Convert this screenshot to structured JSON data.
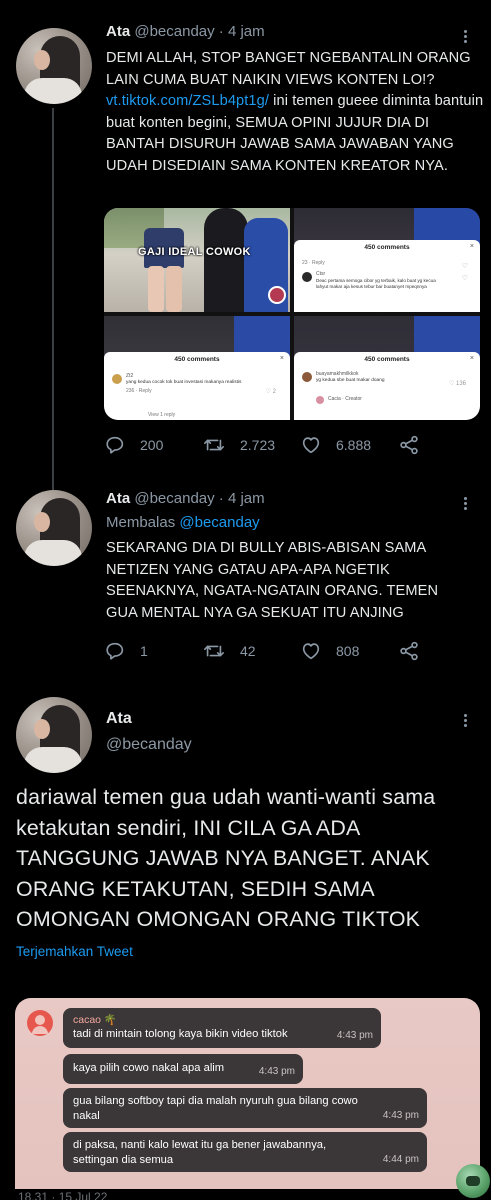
{
  "tweets": [
    {
      "name": "Ata",
      "handle_time": "@becanday · 4 jam",
      "text_parts": {
        "p1": "DEMI ALLAH, STOP BANGET NGEBANTALIN ORANG LAIN CUMA BUAT NAIKIN VIEWS KONTEN LO!? ",
        "link": "vt.tiktok.com/ZSLb4pt1g/",
        "p2": " ini temen gueee diminta bantuin buat konten begini, SEMUA OPINI JUJUR DIA DI BANTAH DISURUH JAWAB SAMA JAWABAN YANG UDAH DISEDIAIN SAMA KONTEN KREATOR NYA."
      },
      "media": {
        "overlay_text": "GAJI IDEAL COWOK",
        "comments_header": "450 comments",
        "comment_username": "Ctsr",
        "comment_text": "Deac pertama semoga cibor yg terbaik, kalo buat yg kecua lahyut makar aja kesus tebur bar buatanyet mpeqnnya",
        "comment_user_2": "Zt2",
        "comment_text_2": "yang kedua cocok tok buat investasi makanya realistis",
        "comment_user_3": "buayamakhmilkkok",
        "comment_text_3": "yg kedua sbe buat makar doang",
        "comment_reply_user": "Cacia · Creator",
        "view_replies": "View 1 reply"
      },
      "replies": "200",
      "retweets": "2.723",
      "likes": "6.888"
    },
    {
      "name": "Ata",
      "handle_time": "@becanday · 4 jam",
      "replying_label": "Membalas",
      "replying_handle": "@becanday",
      "text": "SEKARANG DIA DI BULLY ABIS-ABISAN SAMA NETIZEN YANG GATAU APA-APA NGETIK SEENAKNYA, NGATA-NGATAIN ORANG. TEMEN GUA MENTAL NYA GA SEKUAT ITU ANJING",
      "replies": "1",
      "retweets": "42",
      "likes": "808"
    }
  ],
  "focused_tweet": {
    "name": "Ata",
    "handle": "@becanday",
    "text": "dariawal temen gua udah wanti-wanti sama ketakutan sendiri, INI CILA GA ADA TANGGUNG JAWAB NYA BANGET. ANAK ORANG KETAKUTAN, SEDIH SAMA OMONGAN OMONGAN ORANG TIKTOK",
    "translate_label": "Terjemahkan Tweet"
  },
  "chat": {
    "sender": "cacao 🌴",
    "messages": [
      {
        "text": "tadi di mintain tolong kaya bikin video tiktok",
        "time": "4:43 pm"
      },
      {
        "text": "kaya pilih cowo nakal apa alim",
        "time": "4:43 pm"
      },
      {
        "text": "gua bilang softboy tapi dia malah nyuruh gua bilang cowo nakal",
        "time": "4:43 pm"
      },
      {
        "text": "di paksa, nanti kalo lewat itu ga bener jawabannya, settingan dia semua",
        "time": "4:44 pm"
      }
    ]
  },
  "footer_date": "18.31 · 15 Jul 22",
  "colors": {
    "background": "#000000",
    "link": "#1d9bf0",
    "muted": "#8b98a5",
    "chat_background": "#e8c7c3",
    "bubble": "#3b3637"
  },
  "icons": [
    "more-icon",
    "reply-icon",
    "retweet-icon",
    "like-icon",
    "share-icon",
    "avatar",
    "fab-icon"
  ]
}
